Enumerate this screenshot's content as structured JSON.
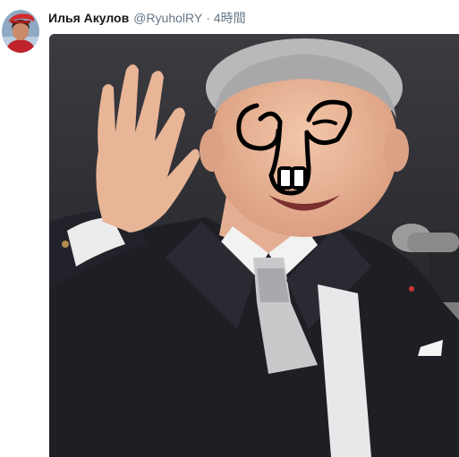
{
  "tweet": {
    "author_name": "Илья Акулов",
    "author_handle": "@RyuholRY",
    "separator": "·",
    "timestamp": "4時間",
    "avatar_icon": "user-avatar",
    "media": {
      "kind": "photo",
      "description_icon": "photo-man-waving-with-doodled-face"
    }
  },
  "colors": {
    "name_text": "#14171a",
    "secondary_text": "#657786",
    "background": "#ffffff"
  }
}
